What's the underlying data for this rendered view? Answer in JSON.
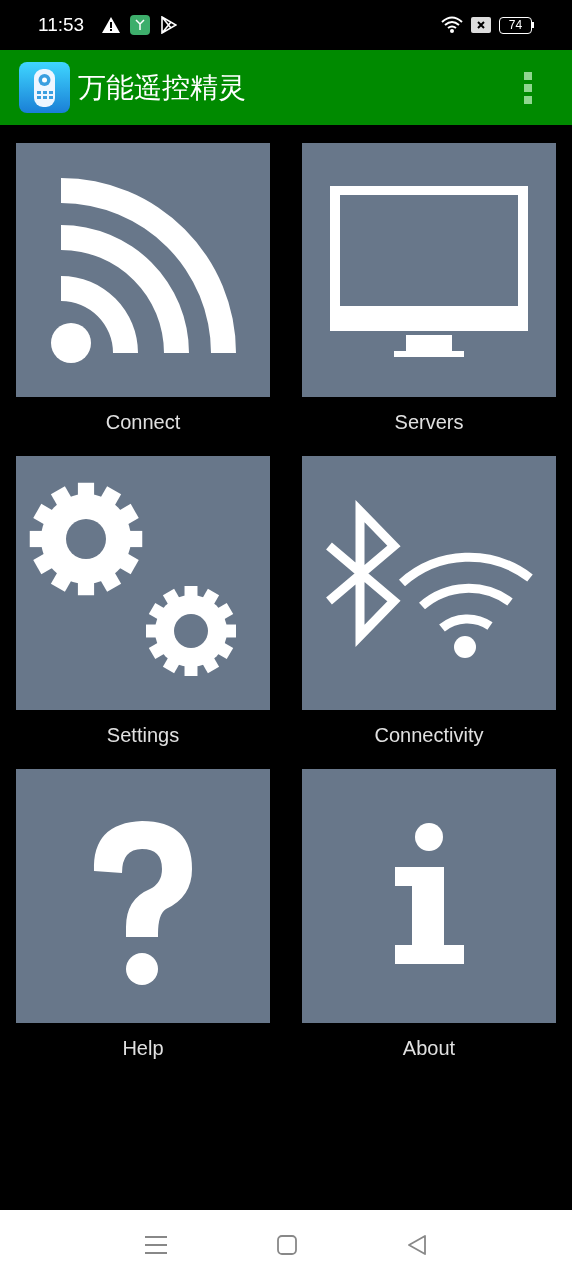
{
  "status_bar": {
    "time": "11:53",
    "battery": "74"
  },
  "app_bar": {
    "title": "万能遥控精灵"
  },
  "tiles": [
    {
      "label": "Connect",
      "kind": "signal"
    },
    {
      "label": "Servers",
      "kind": "monitor"
    },
    {
      "label": "Settings",
      "kind": "gears"
    },
    {
      "label": "Connectivity",
      "kind": "bluetooth-wifi"
    },
    {
      "label": "Help",
      "kind": "question"
    },
    {
      "label": "About",
      "kind": "info"
    }
  ]
}
